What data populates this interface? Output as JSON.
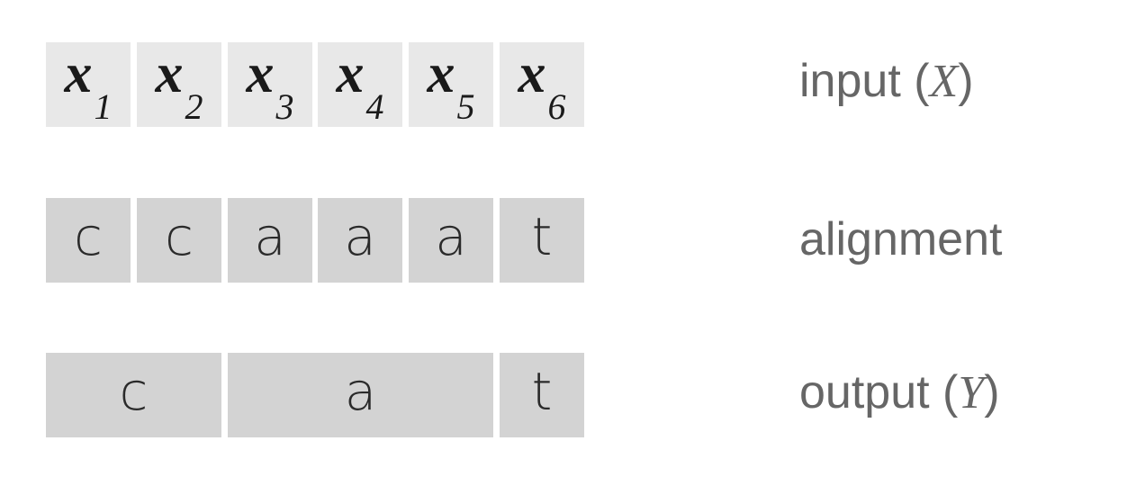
{
  "input_row": {
    "tokens": [
      {
        "var": "x",
        "sub": "1"
      },
      {
        "var": "x",
        "sub": "2"
      },
      {
        "var": "x",
        "sub": "3"
      },
      {
        "var": "x",
        "sub": "4"
      },
      {
        "var": "x",
        "sub": "5"
      },
      {
        "var": "x",
        "sub": "6"
      }
    ],
    "label_prefix": "input (",
    "label_symbol": "X",
    "label_suffix": ")"
  },
  "alignment_row": {
    "tokens": [
      "c",
      "c",
      "a",
      "a",
      "a",
      "t"
    ],
    "label": "alignment"
  },
  "output_row": {
    "tokens": [
      "c",
      "a",
      "t"
    ],
    "label_prefix": "output (",
    "label_symbol": "Y",
    "label_suffix": ")"
  },
  "colors": {
    "input_cell": "#e8e8e8",
    "grey_cell": "#d3d3d3",
    "label_text": "#666666"
  }
}
